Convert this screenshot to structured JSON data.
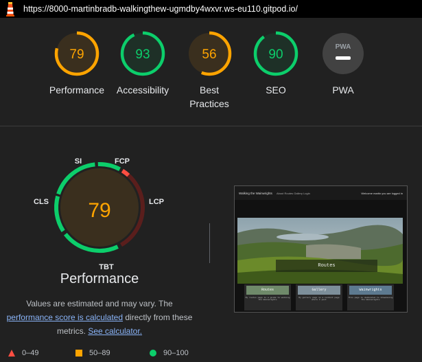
{
  "browser": {
    "url": "https://8000-martinbradb-walkingthew-ugmdby4wxvr.ws-eu110.gitpod.io/"
  },
  "categories": [
    {
      "name": "Performance",
      "score": 79,
      "color": "#ffa400",
      "fill": "#3a2f1e"
    },
    {
      "name": "Accessibility",
      "score": 93,
      "color": "#0cce6b",
      "fill": "#1e3027"
    },
    {
      "name": "Best\nPractices",
      "score": 56,
      "color": "#ffa400",
      "fill": "#3a2f1e"
    },
    {
      "name": "SEO",
      "score": 90,
      "color": "#0cce6b",
      "fill": "#1e3027"
    },
    {
      "name": "PWA",
      "score": null,
      "badge": "PWA",
      "color": "#9aa0a6",
      "fill": "#424242"
    }
  ],
  "performance": {
    "score": 79,
    "title": "Performance",
    "metrics": [
      {
        "abbr": "SI",
        "status": "pass"
      },
      {
        "abbr": "FCP",
        "status": "pass"
      },
      {
        "abbr": "LCP",
        "status": "fail"
      },
      {
        "abbr": "TBT",
        "status": "pass"
      },
      {
        "abbr": "CLS",
        "status": "pass"
      }
    ],
    "description": {
      "line1": "Values are estimated and may vary. The",
      "link1": "performance score is calculated",
      "mid": " directly from these",
      "line3": "metrics. ",
      "link2": "See calculator."
    }
  },
  "legend": [
    {
      "shape": "triangle",
      "range": "0–49",
      "color": "#ff4e42"
    },
    {
      "shape": "square",
      "range": "50–89",
      "color": "#ffa400"
    },
    {
      "shape": "circle",
      "range": "90–100",
      "color": "#0cce6b"
    }
  ],
  "screenshot": {
    "brand": "Walking the Wainwrights",
    "nav_links": "About  Routes  Gallery  Login",
    "nav_right": "Welcome martin you are logged in",
    "hero_title": "Routes",
    "cards": [
      {
        "title": "Routes",
        "desc": "My routes page is a guide to walking the Wainwrights"
      },
      {
        "title": "Gallery",
        "desc": "My gallery page is a content page where I post"
      },
      {
        "title": "Wainwrights",
        "desc": "This page is dedicated to showcasing the Wainwrights"
      }
    ]
  },
  "colors": {
    "pass": "#0cce6b",
    "average": "#ffa400",
    "fail": "#ff4e42",
    "link": "#8ab4f8"
  }
}
